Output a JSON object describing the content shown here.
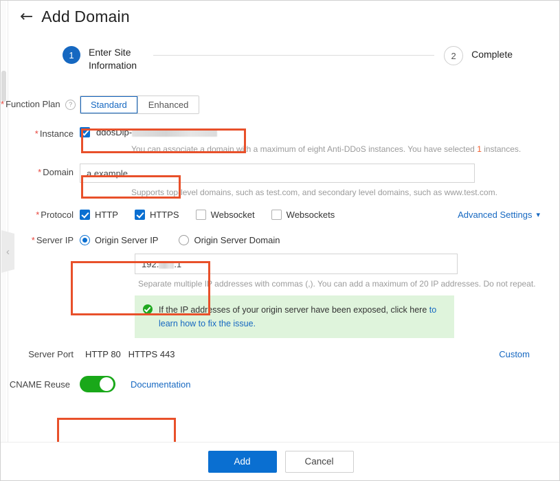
{
  "header": {
    "back_icon": "arrow-left-icon",
    "title": "Add Domain"
  },
  "stepper": {
    "steps": [
      {
        "number": "1",
        "label": "Enter Site Information",
        "state": "active"
      },
      {
        "number": "2",
        "label": "Complete",
        "state": "idle"
      }
    ]
  },
  "form": {
    "function_plan": {
      "label": "Function Plan",
      "required": true,
      "help_icon": "question-circle-icon",
      "options": [
        "Standard",
        "Enhanced"
      ],
      "selected": "Standard"
    },
    "instance": {
      "label": "Instance",
      "required": true,
      "checked": true,
      "value": "ddosDip-",
      "redacted": true,
      "hint_prefix": "You can associate a domain with a maximum of eight Anti-DDoS instances. You have selected ",
      "hint_count": "1",
      "hint_suffix": " instances."
    },
    "domain": {
      "label": "Domain",
      "required": true,
      "value": "a.example",
      "hint": "Supports top-level domains, such as test.com, and secondary level domains, such as www.test.com."
    },
    "protocol": {
      "label": "Protocol",
      "required": true,
      "options": [
        {
          "label": "HTTP",
          "checked": true
        },
        {
          "label": "HTTPS",
          "checked": true
        },
        {
          "label": "Websocket",
          "checked": false
        },
        {
          "label": "Websockets",
          "checked": false
        }
      ],
      "advanced_settings_label": "Advanced Settings",
      "advanced_settings_icon": "chevron-down-icon"
    },
    "server_ip": {
      "label": "Server IP",
      "required": true,
      "options": [
        {
          "label": "Origin Server IP",
          "selected": true
        },
        {
          "label": "Origin Server Domain",
          "selected": false
        }
      ],
      "ip_value_prefix": "192.",
      "ip_value_suffix": ".1",
      "hint": "Separate multiple IP addresses with commas (,). You can add a maximum of 20 IP addresses. Do not repeat."
    },
    "alert": {
      "icon": "check-circle-icon",
      "text": "If the IP addresses of your origin server have been exposed, click here ",
      "link_text": "to learn how to fix the issue."
    },
    "server_port": {
      "label": "Server Port",
      "values": "HTTP 80   HTTPS 443",
      "custom_label": "Custom"
    },
    "cname_reuse": {
      "label": "CNAME Reuse",
      "enabled": true,
      "documentation_label": "Documentation"
    }
  },
  "footer": {
    "add_label": "Add",
    "cancel_label": "Cancel"
  },
  "colors": {
    "accent_blue": "#0a6fd1",
    "annotation_red": "#e8502a",
    "toggle_green": "#19a819",
    "alert_green_bg": "#dff4dc",
    "required_red": "#e8453c"
  }
}
